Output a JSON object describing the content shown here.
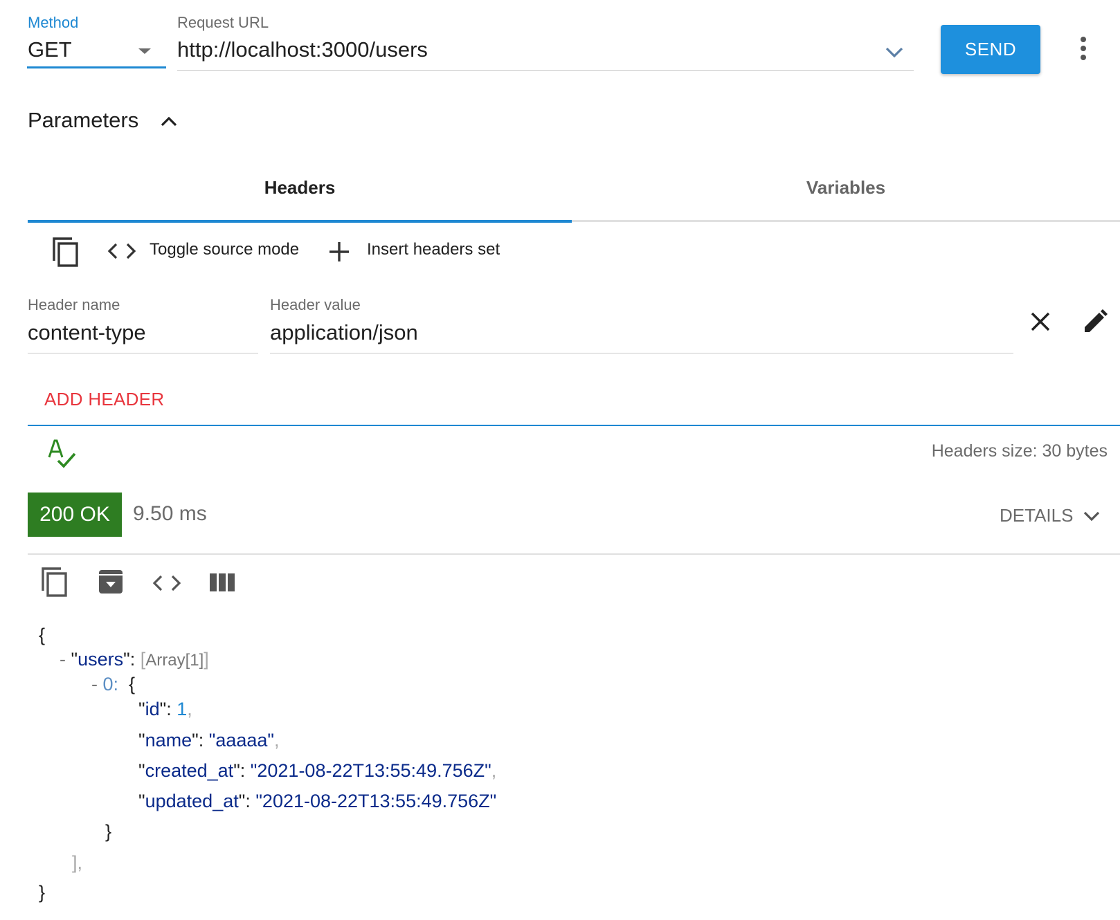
{
  "request": {
    "method_label": "Method",
    "method_value": "GET",
    "url_label": "Request URL",
    "url_value": "http://localhost:3000/users",
    "send_label": "SEND"
  },
  "parameters": {
    "title": "Parameters",
    "tabs": [
      {
        "label": "Headers",
        "active": true
      },
      {
        "label": "Variables",
        "active": false
      }
    ],
    "toolbar": {
      "toggle_source_label": "Toggle source mode",
      "insert_headers_label": "Insert headers set"
    },
    "header_row": {
      "name_label": "Header name",
      "name_value": "content-type",
      "value_label": "Header value",
      "value_value": "application/json"
    },
    "add_header_label": "ADD HEADER",
    "headers_size_text": "Headers size: 30 bytes"
  },
  "response": {
    "status": "200 OK",
    "timing": "9.50 ms",
    "details_label": "DETAILS",
    "json": {
      "open_brace": "{",
      "users_key": "users",
      "array_label": "Array[1]",
      "index": "0:",
      "id_key": "id",
      "id_value": "1",
      "name_key": "name",
      "name_value": "aaaaa",
      "created_key": "created_at",
      "created_value": "2021-08-22T13:55:49.756Z",
      "updated_key": "updated_at",
      "updated_value": "2021-08-22T13:55:49.756Z",
      "close_brace": "}"
    }
  },
  "colors": {
    "accent": "#1e88d2",
    "send": "#1e90dd",
    "status_ok": "#2e7d22",
    "add_header": "#e8363e",
    "json_key": "#0a2a8a",
    "json_number": "#1e88d2"
  },
  "icons": {
    "method_dropdown": "caret-down-icon",
    "url_history": "chevron-down-icon",
    "more": "more-vert-icon",
    "params_toggle": "chevron-up-icon",
    "copy": "copy-icon",
    "source": "code-icon",
    "insert": "plus-icon",
    "remove": "close-icon",
    "edit": "pencil-icon",
    "spellcheck": "spellcheck-icon",
    "details": "chevron-down-icon",
    "save": "archive-download-icon",
    "columns": "columns-icon"
  }
}
